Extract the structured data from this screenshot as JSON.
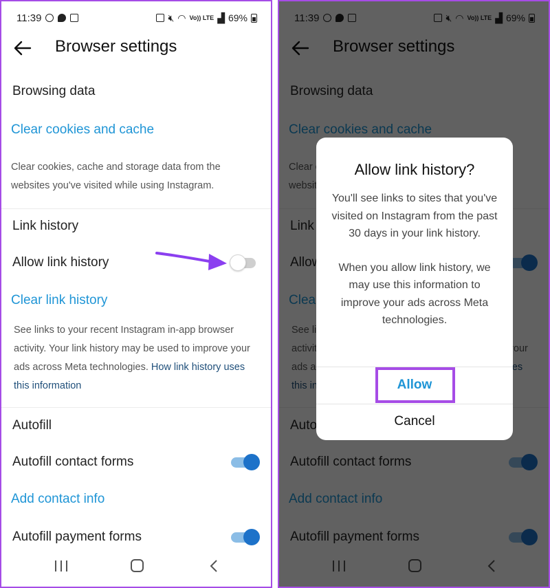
{
  "status_bar": {
    "time": "11:39",
    "battery": "69%",
    "network_label": "Vo)) LTE"
  },
  "header": {
    "title": "Browser settings"
  },
  "browsing_data": {
    "section_title": "Browsing data",
    "clear_cookies_link": "Clear cookies and cache",
    "description": "Clear cookies, cache and storage data from the websites you've visited while using Instagram."
  },
  "link_history": {
    "section_title": "Link history",
    "allow_label": "Allow link history",
    "clear_link": "Clear link history",
    "description": "See links to your recent Instagram in-app browser activity. Your link history may be used to improve your ads across Meta technologies.",
    "description_link": "How link history uses this information"
  },
  "autofill": {
    "section_title": "Autofill",
    "contact_label": "Autofill contact forms",
    "add_contact_link": "Add contact info",
    "payment_label": "Autofill payment forms"
  },
  "toggles": {
    "left_allow_link_history": "off",
    "right_allow_link_history": "on",
    "autofill_contact": "on",
    "autofill_payment": "on"
  },
  "dialog": {
    "title": "Allow link history?",
    "body_p1": "You'll see links to sites that you've visited on Instagram from the past 30 days in your link history.",
    "body_p2": "When you allow link history, we may use this information to improve your ads across Meta technologies.",
    "allow_button": "Allow",
    "cancel_button": "Cancel"
  },
  "colors": {
    "link": "#1f95d6",
    "toggle_on": "#1d72c9",
    "highlight": "#a64ce6",
    "annotation_arrow": "#8b3ff0"
  },
  "icons": {
    "back": "arrow-left-icon",
    "nav_recent": "recent-apps-icon",
    "nav_home": "home-icon",
    "nav_back": "chevron-left-icon"
  }
}
